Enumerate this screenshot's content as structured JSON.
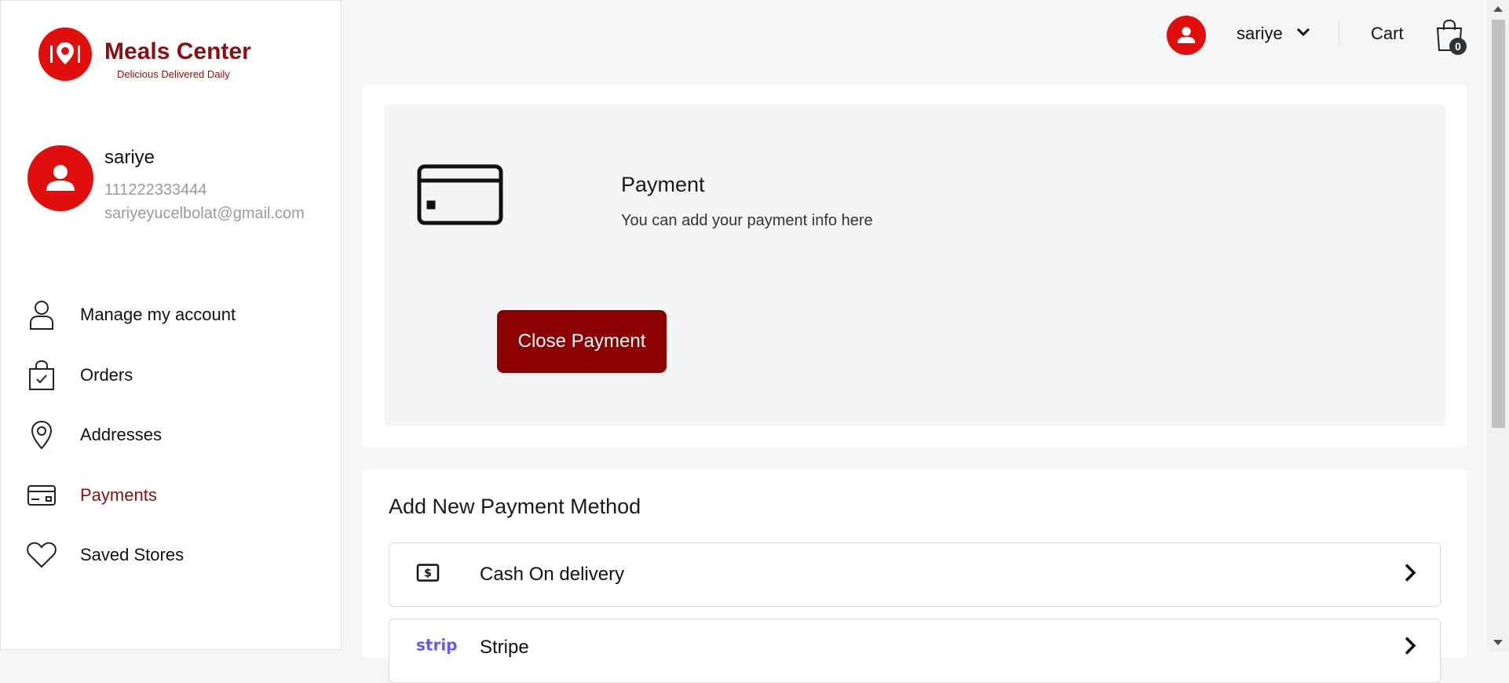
{
  "brand": {
    "name": "Meals Center",
    "tagline": "Delicious Delivered Daily",
    "primary_color": "#e10e0e",
    "dark_red": "#8b0000"
  },
  "profile": {
    "name": "sariye",
    "phone": "111222333444",
    "email": "sariyeyucelbolat@gmail.com"
  },
  "sidebar": {
    "items": [
      {
        "label": "Manage my account",
        "icon": "user-outline-icon",
        "active": false
      },
      {
        "label": "Orders",
        "icon": "shopping-bag-check-icon",
        "active": false
      },
      {
        "label": "Addresses",
        "icon": "location-pin-icon",
        "active": false
      },
      {
        "label": "Payments",
        "icon": "credit-card-icon",
        "active": true
      },
      {
        "label": "Saved Stores",
        "icon": "heart-icon",
        "active": false
      }
    ]
  },
  "topbar": {
    "username": "sariye",
    "cart_label": "Cart",
    "cart_count": "0"
  },
  "payment_panel": {
    "title": "Payment",
    "subtitle": "You can add your payment info here",
    "close_button": "Close Payment"
  },
  "add_payment": {
    "title": "Add New Payment Method",
    "methods": [
      {
        "label": "Cash On delivery",
        "icon": "cash-bill-icon"
      },
      {
        "label": "Stripe",
        "icon": "stripe-logo-icon"
      }
    ]
  }
}
